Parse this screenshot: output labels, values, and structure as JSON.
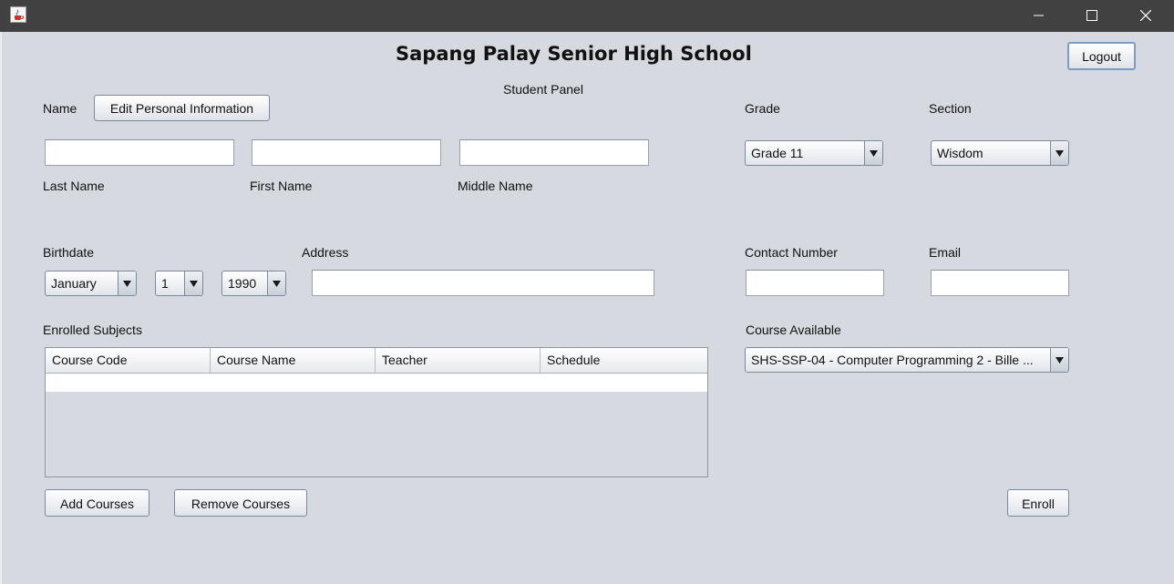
{
  "window": {
    "heading": "Sapang Palay Senior High School",
    "subheading": "Student Panel"
  },
  "header": {
    "logout_label": "Logout"
  },
  "personal": {
    "name_label": "Name",
    "edit_button_label": "Edit Personal Information",
    "last_name_label": "Last Name",
    "first_name_label": "First Name",
    "middle_name_label": "Middle Name",
    "last_name_value": "",
    "first_name_value": "",
    "middle_name_value": ""
  },
  "grade": {
    "label": "Grade",
    "selected": "Grade 11"
  },
  "section": {
    "label": "Section",
    "selected": "Wisdom"
  },
  "birthdate": {
    "label": "Birthdate",
    "month": "January",
    "day": "1",
    "year": "1990"
  },
  "address": {
    "label": "Address",
    "value": ""
  },
  "contact": {
    "label": "Contact Number",
    "value": ""
  },
  "email": {
    "label": "Email",
    "value": ""
  },
  "enrolled": {
    "label": "Enrolled Subjects",
    "columns": [
      "Course Code",
      "Course Name",
      "Teacher",
      "Schedule"
    ],
    "rows": []
  },
  "course_available": {
    "label": "Course Available",
    "selected": "SHS-SSP-04 - Computer Programming 2 - Bille ..."
  },
  "actions": {
    "add_courses_label": "Add Courses",
    "remove_courses_label": "Remove Courses",
    "enroll_label": "Enroll"
  },
  "icons": {
    "app": "java-cup-icon",
    "minimize": "minimize-icon",
    "maximize": "maximize-icon",
    "close": "close-icon",
    "dropdown": "triangle-down-icon"
  },
  "colors": {
    "titlebar": "#414141",
    "background": "#d6d9df",
    "button_border": "#7a8a9c",
    "focus_border": "#7d9cc5"
  }
}
